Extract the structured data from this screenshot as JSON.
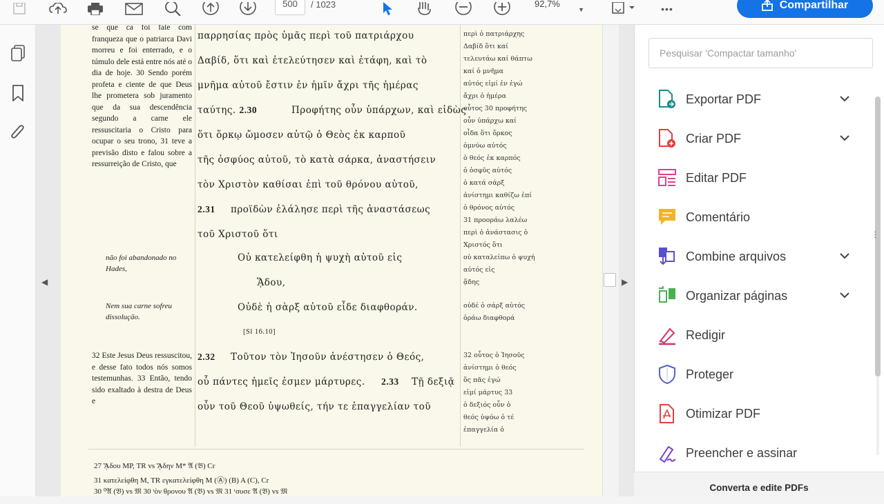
{
  "toolbar": {
    "page_current": "500",
    "page_total": "/ 1023",
    "zoom": "92,7%",
    "share_label": "Compartilhar",
    "more_label": "•••"
  },
  "document": {
    "pt_col": "se que ca foi fale com franqueza que o patriarca Davi morreu e foi enterrado, e o túmulo dele está entre nós até o dia de hoje. 30 Sendo porém profeta e ciente de que Deus lhe prometera sob juramento que da sua descendência segundo a carne ele ressuscitaria o Cristo para ocupar o seu trono, 31 teve a previsão disto e falou sobre a ressurreição de Cristo, que",
    "pt_hades": "não foi abandonado no Hades,",
    "pt_carne": "Nem sua carne sofreu dissolução.",
    "pt_32": "32 Este Jesus Deus ressuscitou, e desse fato todos nós somos testemunhas. 33 Então, tendo sido exaltado à destra de Deus e",
    "gk": [
      "παρρησίας   πρὸς   ὑμᾶς   περὶ   τοῦ   πατριάρχου",
      "Δαβίδ,   ὅτι   καὶ   ἐτελεύτησεν   καὶ   ἐτάφη,   καὶ   τὸ",
      "μνῆμα   αὐτοῦ   ἔστιν   ἐν   ἡμῖν   ἄχρι   τῆς   ἡμέρας",
      "Προφήτης   οὖν   ὑπάρχων,   καὶ   εἰδὼς",
      "ὅτι   ὅρκῳ   ὤμοσεν   αὐτῷ   ὁ   Θεὸς   ἐκ   καρποῦ",
      "τῆς   ὀσφύος   αὐτοῦ,   τὸ   κατὰ   σάρκα,   ἀναστήσειν",
      "τὸν   Χριστὸν   καθίσαι   ἐπὶ   τοῦ   θρόνου   αὐτοῦ,",
      "προϊδὼν   ἐλάλησε   περὶ   τῆς   ἀναστάσεως",
      "τοῦ   Χριστοῦ   ὅτι",
      "Οὐ   κατελείφθη   ἡ   ψυχὴ   αὐτοῦ   εἰς",
      "ᾍδου,",
      "Οὐδὲ   ἡ   σὰρξ   αὐτοῦ   εἶδε   διαφθοράν.",
      "[Sl 16.10]",
      "Τοῦτον   τὸν   Ἰησοῦν   ἀνέστησεν   ὁ   Θεός,",
      "οὗ   πάντες   ἡμεῖς   ἐσμεν   μάρτυρες.",
      "Τῇ   δεξιᾷ",
      "οὖν   τοῦ   Θεοῦ   ὑψωθείς,   τήν   τε   ἐπαγγελίαν   τοῦ"
    ],
    "verse_labels": [
      "ταύτης.",
      "2.30",
      "2.31",
      "2.32",
      "2.33"
    ],
    "rc": [
      "περὶ ὁ πατριάρχης",
      "Δαβίδ ὅτι καί",
      "τελευτάω καί θάπτω",
      "καί ὁ μνῆμα",
      "αὐτός εἰμί ἐν ἐγώ",
      "ἄχρι ὁ ἡμέρα",
      "οὗτος 30 προφήτης",
      "οὖν ὑπάρχω καί",
      "οἶδα ὅτι ὅρκος",
      "ὀμνύω αὐτός",
      "ὁ θεός ἐκ καρπός",
      "ὁ ὀσφῦς αὐτός",
      "ὁ κατά σάρξ",
      "ἀνίστημι καθίζω ἐπί",
      "ὁ θρόνος αὐτός",
      "31 προοράω λαλέω",
      "περὶ ὁ ἀνάστασις ὁ",
      "Χριστός ὅτι",
      "οὐ καταλείπω ὁ ψυχή",
      "αὐτός εἰς",
      "ᾅδης",
      "οὐδέ ὁ σάρξ αὐτός",
      "ὁράω διαφθορά",
      "32 οὗτος ὁ Ἰησοῦς",
      "ἀνίστημι ὁ θεός",
      "ὅς πᾶς ἐγώ",
      "εἰμί μάρτυς 33",
      "ὁ δεξιός οὖν ὁ",
      "θεός ὑψόω ὁ τέ",
      "ἐπαγγελία ὁ"
    ],
    "footnotes": [
      "27 ᾍδου ΜΡ, TR vs ᾍδην Μ* 𝔄 (𝔅) Cr",
      "31 κατελείφθη M, TR εγκατελείφθη M (Ⓐ) (B) A (C), Cr",
      "30 ⁰𝔄 (𝔅)  vs 𝔐   30 ᵗὸν θρονου 𝔄 (𝔅) vs 𝔐   31 ᵗσυσε 𝔄 (𝔅) vs 𝔐"
    ]
  },
  "right_panel": {
    "search_placeholder": "Pesquisar 'Compactar tamanho'",
    "tools": [
      {
        "label": "Exportar PDF",
        "icon": "export-pdf-icon",
        "color": "#1a8c8a",
        "chevron": true
      },
      {
        "label": "Criar PDF",
        "icon": "create-pdf-icon",
        "color": "#e0413d",
        "chevron": true
      },
      {
        "label": "Editar PDF",
        "icon": "edit-pdf-icon",
        "color": "#e0418e",
        "chevron": false
      },
      {
        "label": "Comentário",
        "icon": "comment-icon",
        "color": "#f0b429",
        "chevron": false
      },
      {
        "label": "Combine arquivos",
        "icon": "combine-files-icon",
        "color": "#5a4fcf",
        "chevron": true
      },
      {
        "label": "Organizar páginas",
        "icon": "organize-pages-icon",
        "color": "#4caf50",
        "chevron": true
      },
      {
        "label": "Redigir",
        "icon": "redact-icon",
        "color": "#d6306c",
        "chevron": false
      },
      {
        "label": "Proteger",
        "icon": "protect-icon",
        "color": "#5c5fc8",
        "chevron": false
      },
      {
        "label": "Otimizar PDF",
        "icon": "optimize-pdf-icon",
        "color": "#e0413d",
        "chevron": false
      },
      {
        "label": "Preencher e assinar",
        "icon": "fill-sign-icon",
        "color": "#7b3fd1",
        "chevron": false
      }
    ],
    "footer": "Converta e edite PDFs"
  }
}
